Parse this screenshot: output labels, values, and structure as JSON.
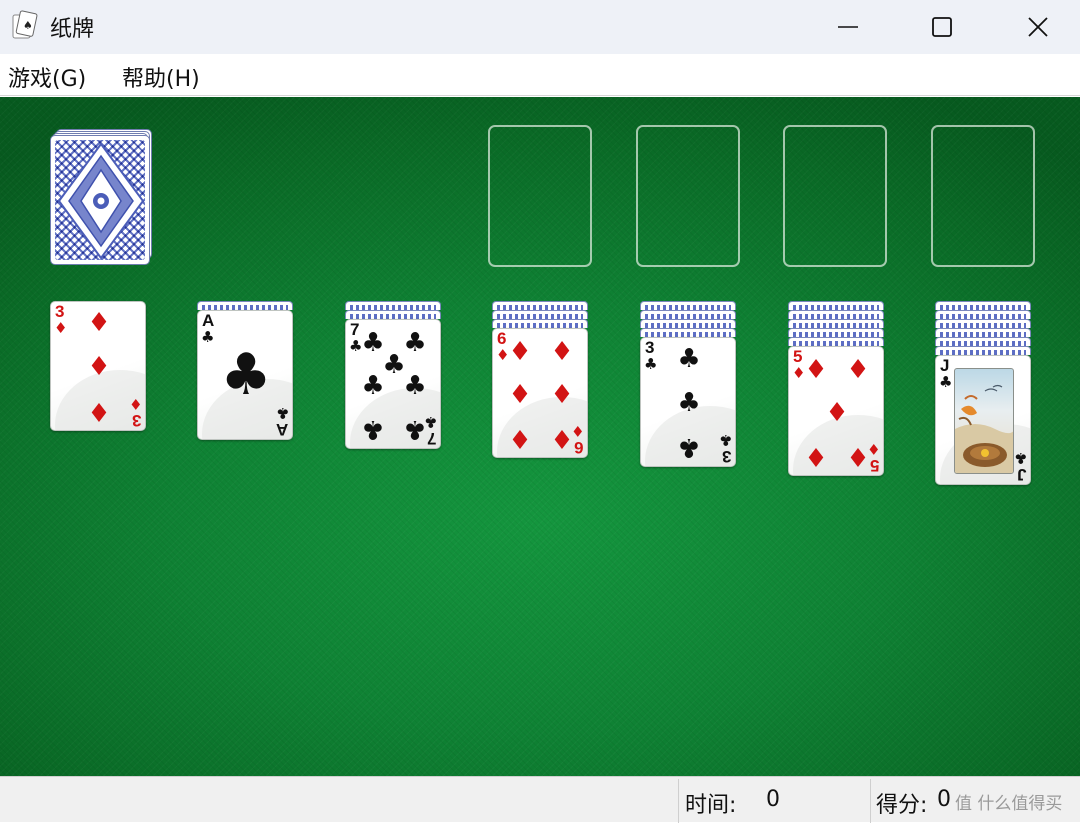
{
  "window": {
    "title": "纸牌"
  },
  "menu": {
    "items": [
      "游戏(G)",
      "帮助(H)"
    ]
  },
  "status": {
    "time_label": "时间:",
    "time_value": "0",
    "score_label": "得分:",
    "score_value": "0"
  },
  "watermark": "值 什么值得买",
  "colors": {
    "felt": "#0f8234",
    "red_suit": "#d21414",
    "black_suit": "#111111",
    "card_back": "#6474c4"
  },
  "stock": {
    "face_down": true
  },
  "foundations": [
    {
      "empty": true
    },
    {
      "empty": true
    },
    {
      "empty": true
    },
    {
      "empty": true
    }
  ],
  "tableau": [
    {
      "hidden": 0,
      "top": {
        "rank": "3",
        "suit": "diamond",
        "symbol": "♦",
        "color": "red"
      }
    },
    {
      "hidden": 1,
      "top": {
        "rank": "A",
        "suit": "club",
        "symbol": "♣",
        "color": "black"
      }
    },
    {
      "hidden": 2,
      "top": {
        "rank": "7",
        "suit": "club",
        "symbol": "♣",
        "color": "black"
      }
    },
    {
      "hidden": 3,
      "top": {
        "rank": "6",
        "suit": "diamond",
        "symbol": "♦",
        "color": "red"
      }
    },
    {
      "hidden": 4,
      "top": {
        "rank": "3",
        "suit": "club",
        "symbol": "♣",
        "color": "black"
      }
    },
    {
      "hidden": 5,
      "top": {
        "rank": "5",
        "suit": "diamond",
        "symbol": "♦",
        "color": "red"
      }
    },
    {
      "hidden": 6,
      "top": {
        "rank": "J",
        "suit": "club",
        "symbol": "♣",
        "color": "black"
      }
    }
  ]
}
